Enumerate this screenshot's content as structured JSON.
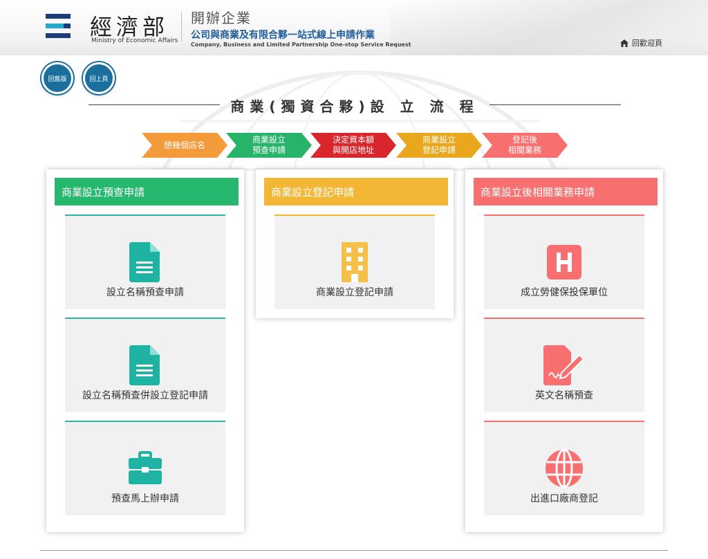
{
  "header": {
    "ministry_zh": "經濟部",
    "ministry_en": "Ministry of Economic Affairs",
    "site_title": "開辦企業",
    "site_subtitle": "公司與商業及有限合夥一站式線上申請作業",
    "site_en": "Company, Business and Limited Partnership One-stop Service Request",
    "home_label": "回歡迎頁",
    "home_icon": "home-icon"
  },
  "nav": {
    "old_version_label": "回舊版",
    "back_label": "回上頁"
  },
  "flow": {
    "title": "商業(獨資合夥)設 立 流 程",
    "steps": [
      {
        "line1": "想幾個店名",
        "line2": "",
        "color": "#f39a3a"
      },
      {
        "line1": "商業設立",
        "line2": "預查申請",
        "color": "#27b36a"
      },
      {
        "line1": "決定資本額",
        "line2": "與開店地址",
        "color": "#d9262d"
      },
      {
        "line1": "商業設立",
        "line2": "登記申請",
        "color": "#e8a71c"
      },
      {
        "line1": "登記後",
        "line2": "相關業務",
        "color": "#f86f6f"
      }
    ]
  },
  "cards": {
    "prereview": {
      "title": "商業設立預查申請",
      "color": "#27b86f",
      "tiles": [
        {
          "label": "設立名稱預查申請",
          "icon": "document-icon"
        },
        {
          "label": "設立名稱預查併設立登記申請",
          "icon": "document-icon"
        },
        {
          "label": "預查馬上辦申請",
          "icon": "briefcase-icon"
        }
      ]
    },
    "registration": {
      "title": "商業設立登記申請",
      "color": "#f4b635",
      "tiles": [
        {
          "label": "商業設立登記申請",
          "icon": "building-icon"
        }
      ]
    },
    "related": {
      "title": "商業設立後相關業務申請",
      "color": "#f86f6f",
      "tiles": [
        {
          "label": "成立勞健保投保單位",
          "icon": "hospital-icon"
        },
        {
          "label": "英文名稱預查",
          "icon": "signature-icon"
        },
        {
          "label": "出進口廠商登記",
          "icon": "globe-icon"
        }
      ]
    }
  }
}
